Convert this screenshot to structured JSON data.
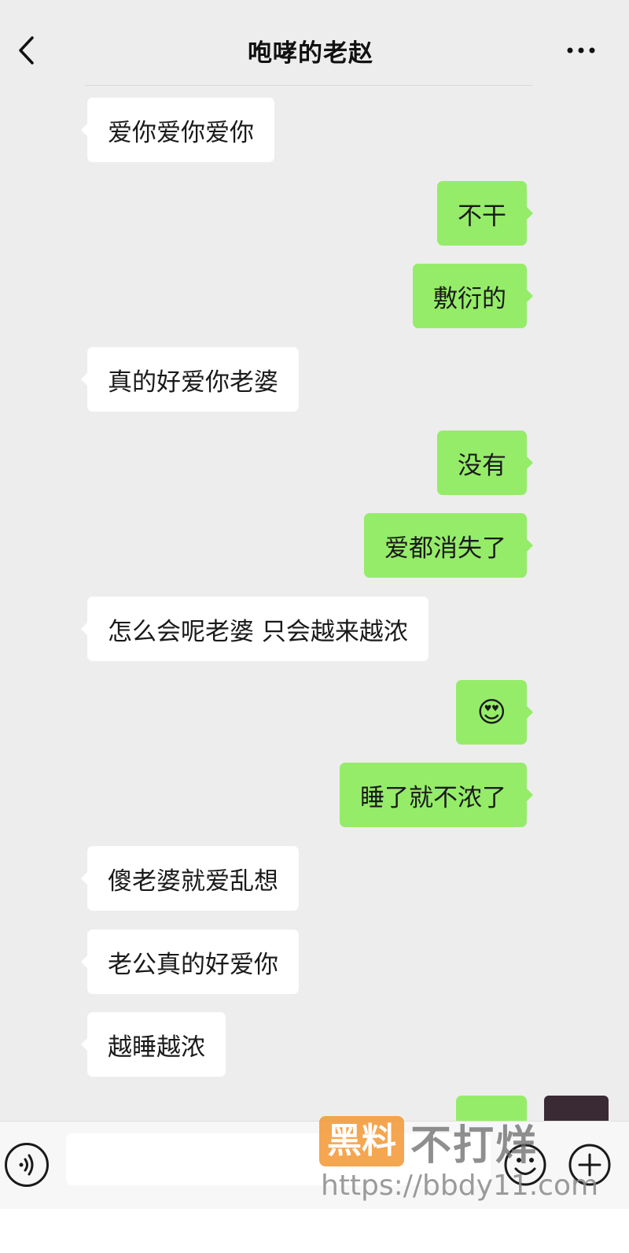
{
  "header": {
    "title": "咆哮的老赵"
  },
  "messages": [
    {
      "side": "left",
      "text": "爱你爱你爱你"
    },
    {
      "side": "right",
      "text": "不干"
    },
    {
      "side": "right",
      "text": "敷衍的"
    },
    {
      "side": "left",
      "text": "真的好爱你老婆"
    },
    {
      "side": "right",
      "text": "没有"
    },
    {
      "side": "right",
      "text": "爱都消失了"
    },
    {
      "side": "left",
      "text": "怎么会呢老婆 只会越来越浓"
    },
    {
      "side": "right",
      "text": "😍"
    },
    {
      "side": "right",
      "text": "睡了就不浓了"
    },
    {
      "side": "left",
      "text": "傻老婆就爱乱想"
    },
    {
      "side": "left",
      "text": "老公真的好爱你"
    },
    {
      "side": "left",
      "text": "越睡越浓"
    }
  ],
  "icons": {
    "back": "chevron-left-icon",
    "more": "ellipsis-icon",
    "voice": "voice-icon",
    "emoji": "smiley-icon",
    "plus": "plus-icon"
  },
  "watermark": {
    "brand_box": "黑料",
    "brand_text": "不打烊",
    "url": "https://bbdy11.com"
  },
  "colors": {
    "background": "#ededed",
    "sent_bubble": "#95ec69",
    "received_bubble": "#ffffff",
    "watermark_orange": "#f39a3a"
  }
}
